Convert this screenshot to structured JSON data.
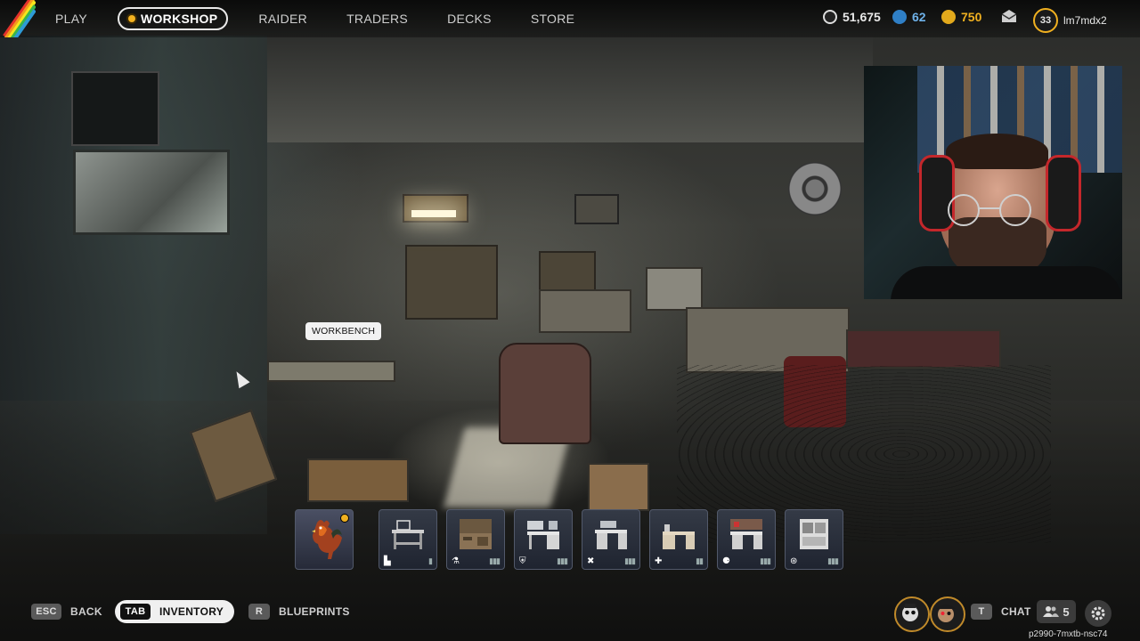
{
  "nav": {
    "items": [
      "PLAY",
      "WORKSHOP",
      "RAIDER",
      "TRADERS",
      "DECKS",
      "STORE"
    ],
    "active": "WORKSHOP"
  },
  "currencies": {
    "credits": "51,675",
    "tokens": "62",
    "coins": "750"
  },
  "player": {
    "level": "33",
    "username": "lm7mdx2"
  },
  "scene": {
    "tooltip": "WORKBENCH"
  },
  "items": [
    {
      "name": "rooster",
      "icon": "",
      "selected": false
    },
    {
      "name": "workbench-1",
      "icon": "▙"
    },
    {
      "name": "workbench-2",
      "icon": "⚗"
    },
    {
      "name": "workbench-3",
      "icon": "⛨"
    },
    {
      "name": "workbench-4",
      "icon": "✖"
    },
    {
      "name": "workbench-5",
      "icon": "✚"
    },
    {
      "name": "workbench-6",
      "icon": "⚈"
    },
    {
      "name": "workbench-7",
      "icon": "⊛"
    }
  ],
  "bottom": {
    "back_key": "ESC",
    "back_label": "BACK",
    "inventory_key": "TAB",
    "inventory_label": "INVENTORY",
    "blueprints_key": "R",
    "blueprints_label": "BLUEPRINTS",
    "chat_key": "T",
    "chat_label": "CHAT",
    "friends_count": "5",
    "session_id": "p2990-7mxtb-nsc74"
  },
  "colors": {
    "accent": "#f0b020",
    "stripe": [
      "#e3322b",
      "#f39a1d",
      "#f6e51b",
      "#3bb54a",
      "#2d9ad6"
    ]
  }
}
